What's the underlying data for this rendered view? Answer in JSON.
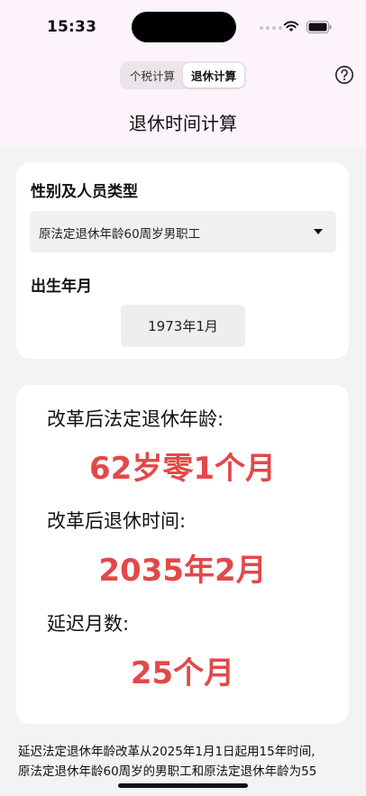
{
  "status_bar": {
    "time": "15:33"
  },
  "header": {
    "tabs": [
      {
        "label": "个税计算",
        "active": false
      },
      {
        "label": "退休计算",
        "active": true
      }
    ],
    "title": "退休时间计算"
  },
  "form": {
    "gender_type_label": "性别及人员类型",
    "gender_type_value": "原法定退休年龄60周岁男职工",
    "birth_label": "出生年月",
    "birth_value": "1973年1月"
  },
  "result": {
    "age_label": "改革后法定退休年龄:",
    "age_value": "62岁零1个月",
    "time_label": "改革后退休时间:",
    "time_value": "2035年2月",
    "delay_label": "延迟月数:",
    "delay_value": "25个月"
  },
  "footnote": {
    "line1": "延迟法定退休年龄改革从2025年1月1日起用15年时间,",
    "line2": "原法定退休年龄60周岁的男职工和原法定退休年龄为55"
  },
  "colors": {
    "accent": "#e34848",
    "header_bg": "#fcf3fb",
    "page_bg": "#f3f3f4"
  },
  "icons": {
    "help": "question-circle-icon",
    "dropdown": "triangle-down-icon"
  }
}
